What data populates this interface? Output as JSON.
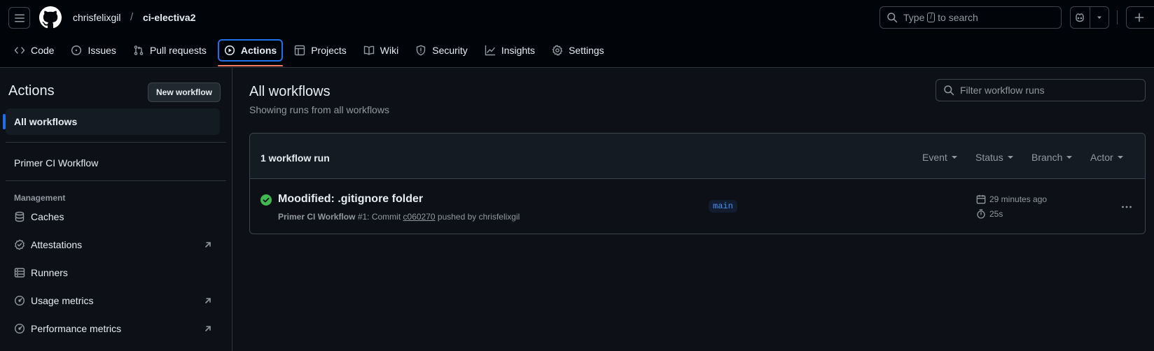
{
  "header": {
    "owner": "chrisfelixgil",
    "separator": "/",
    "repo": "ci-electiva2",
    "search": {
      "prefix": "Type",
      "key": "/",
      "suffix": "to search"
    },
    "icons": [
      "menu-icon",
      "github-logo-icon",
      "search-icon",
      "copilot-icon",
      "triangle-down-icon",
      "plus-icon"
    ]
  },
  "nav": {
    "tabs": [
      {
        "label": "Code",
        "icon": "code-icon"
      },
      {
        "label": "Issues",
        "icon": "issue-opened-icon"
      },
      {
        "label": "Pull requests",
        "icon": "git-pull-request-icon"
      },
      {
        "label": "Actions",
        "icon": "play-icon",
        "active": true
      },
      {
        "label": "Projects",
        "icon": "table-icon"
      },
      {
        "label": "Wiki",
        "icon": "book-icon"
      },
      {
        "label": "Security",
        "icon": "shield-icon"
      },
      {
        "label": "Insights",
        "icon": "graph-icon"
      },
      {
        "label": "Settings",
        "icon": "gear-icon"
      }
    ]
  },
  "sidebar": {
    "title": "Actions",
    "new_workflow": "New workflow",
    "all_workflows": "All workflows",
    "workflows": [
      "Primer CI Workflow"
    ],
    "management_heading": "Management",
    "management": [
      {
        "label": "Caches",
        "icon": "database-icon",
        "external": false
      },
      {
        "label": "Attestations",
        "icon": "verified-icon",
        "external": true
      },
      {
        "label": "Runners",
        "icon": "server-icon",
        "external": false
      },
      {
        "label": "Usage metrics",
        "icon": "meter-icon",
        "external": true
      },
      {
        "label": "Performance metrics",
        "icon": "meter-icon",
        "external": true
      }
    ]
  },
  "main": {
    "title": "All workflows",
    "subtitle": "Showing runs from all workflows",
    "filter_placeholder": "Filter workflow runs",
    "run_count": "1 workflow run",
    "filters": [
      "Event",
      "Status",
      "Branch",
      "Actor"
    ],
    "runs": [
      {
        "title": "Moodified: .gitignore folder",
        "workflow": "Primer CI Workflow",
        "run_number": "#1",
        "commit_prefix": ": Commit",
        "sha": "c060270",
        "pushed_by": "pushed by chrisfelixgil",
        "branch": "main",
        "time_ago": "29 minutes ago",
        "duration": "25s",
        "status": "success"
      }
    ]
  },
  "colors": {
    "background": "#0d1117",
    "header_bg": "#010409",
    "accent": "#1f6feb",
    "tab_underline": "#f78166",
    "success": "#3fb950",
    "branch_text": "#4493f8"
  }
}
